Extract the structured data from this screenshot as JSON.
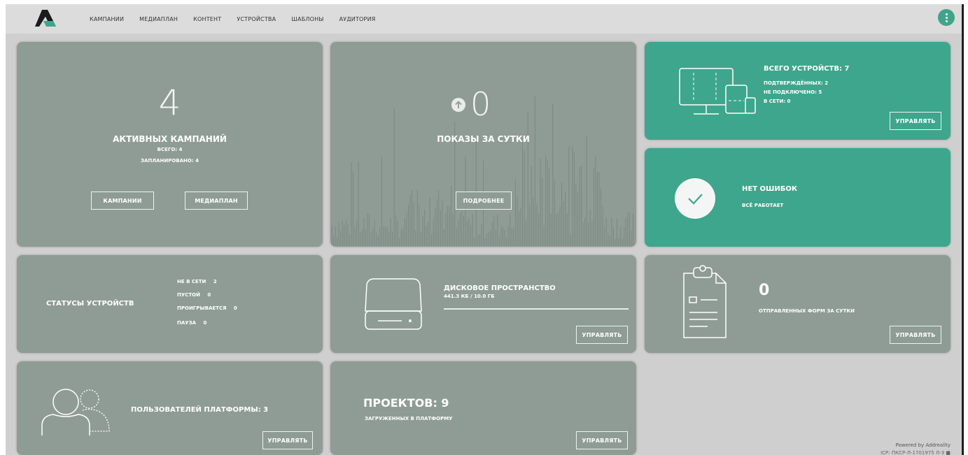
{
  "nav": {
    "items": [
      "КАМПАНИИ",
      "МЕДИАПЛАН",
      "КОНТЕНТ",
      "УСТРОЙСТВА",
      "ШАБЛОНЫ",
      "АУДИТОРИЯ"
    ]
  },
  "campaigns": {
    "count": "4",
    "title": "АКТИВНЫХ КАМПАНИЙ",
    "total": "ВСЕГО: 4",
    "scheduled": "ЗАПЛАНИРОВАНО: 4",
    "btn_campaigns": "КАМПАНИИ",
    "btn_mediaplan": "МЕДИАПЛАН"
  },
  "impressions": {
    "count": "0",
    "title": "ПОКАЗЫ ЗА СУТКИ",
    "btn_details": "ПОДРОБНЕЕ"
  },
  "devices": {
    "title": "ВСЕГО УСТРОЙСТВ: 7",
    "confirmed": "ПОДТВЕРЖДЁННЫХ: 2",
    "not_connected": "НЕ ПОДКЛЮЧЕНО: 5",
    "online": "В СЕТИ: 0",
    "btn_manage": "УПРАВЛЯТЬ"
  },
  "errors": {
    "title": "НЕТ ОШИБОК",
    "subtitle": "ВСЁ РАБОТАЕТ"
  },
  "statuses": {
    "title": "СТАТУСЫ УСТРОЙСТВ",
    "rows": [
      {
        "label": "НЕ В СЕТИ",
        "value": "2"
      },
      {
        "label": "ПУСТОЙ",
        "value": "0"
      },
      {
        "label": "ПРОИГРЫВАЕТСЯ",
        "value": "0"
      },
      {
        "label": "ПАУЗА",
        "value": "0"
      }
    ]
  },
  "disk": {
    "title": "ДИСКОВОЕ ПРОСТРАНСТВО",
    "usage": "441.3 КБ / 10.0 ГБ",
    "used_fraction": 4e-05,
    "btn_manage": "УПРАВЛЯТЬ"
  },
  "forms": {
    "count": "0",
    "title": "ОТПРАВЛЕННЫХ ФОРМ ЗА СУТКИ",
    "btn_manage": "УПРАВЛЯТЬ"
  },
  "users": {
    "title": "ПОЛЬЗОВАТЕЛЕЙ ПЛАТФОРМЫ: 3",
    "btn_manage": "УПРАВЛЯТЬ"
  },
  "projects": {
    "title": "ПРОЕКТОВ: 9",
    "subtitle": "ЗАГРУЖЕННЫХ В ПЛАТФОРМУ",
    "btn_manage": "УПРАВЛЯТЬ"
  },
  "footer": {
    "powered": "Powered by Addreality",
    "id": "ICP: ПКСР-Л-1701975 Л-3 ■"
  },
  "colors": {
    "teal": "#3ea68c",
    "grey_card": "#8f9c96",
    "background": "#cfcfcf"
  }
}
